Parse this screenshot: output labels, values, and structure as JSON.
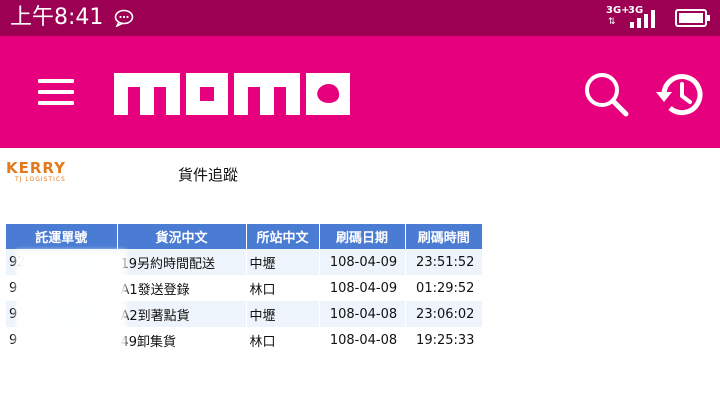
{
  "status_bar": {
    "time": "上午8:41",
    "network_1": "3G+",
    "network_2": "3G"
  },
  "app_bar": {
    "logo_text": "momo",
    "colors": {
      "brand": "#e6007e",
      "status_bar": "#9b0052"
    },
    "icons": [
      "menu-icon",
      "search-icon",
      "history-icon"
    ]
  },
  "carrier": {
    "logo_text": "KERRY",
    "logo_sub": "TJ LOGISTICS"
  },
  "page_title": "貨件追蹤",
  "table": {
    "headers": [
      "託運單號",
      "貨況中文",
      "所站中文",
      "刷碼日期",
      "刷碼時間"
    ],
    "rows": [
      {
        "id": "92",
        "status": "19另約時間配送",
        "station": "中壢",
        "date": "108-04-09",
        "time": "23:51:52"
      },
      {
        "id": "9",
        "status": "A1發送登錄",
        "station": "林口",
        "date": "108-04-09",
        "time": "01:29:52"
      },
      {
        "id": "9",
        "status": "A2到著點貨",
        "station": "中壢",
        "date": "108-04-08",
        "time": "23:06:02"
      },
      {
        "id": "9",
        "status": "49卸集貨",
        "station": "林口",
        "date": "108-04-08",
        "time": "19:25:33"
      }
    ]
  }
}
